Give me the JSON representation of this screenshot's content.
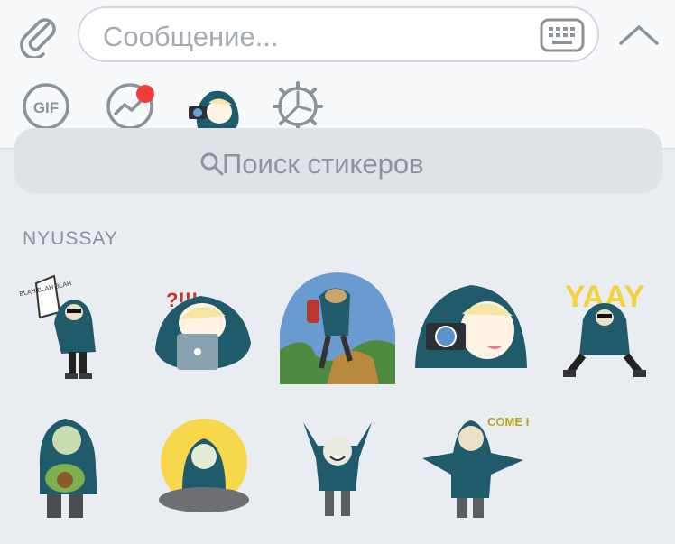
{
  "composer": {
    "placeholder": "Сообщение..."
  },
  "tabs": [
    {
      "name": "gif",
      "label": "GIF"
    },
    {
      "name": "trending"
    },
    {
      "name": "sticker-pack-nyussay"
    },
    {
      "name": "settings"
    }
  ],
  "search": {
    "placeholder": "Поиск стикеров"
  },
  "pack": {
    "title": "NYUSSAY",
    "stickers": [
      {
        "id": 1,
        "caption": "BLAH BLAH BLAH"
      },
      {
        "id": 2,
        "caption": "?!!!"
      },
      {
        "id": 3,
        "caption": ""
      },
      {
        "id": 4,
        "caption": ""
      },
      {
        "id": 5,
        "caption": "YAAY"
      },
      {
        "id": 6,
        "caption": ""
      },
      {
        "id": 7,
        "caption": ""
      },
      {
        "id": 8,
        "caption": ""
      },
      {
        "id": 9,
        "caption": "COME HERE"
      }
    ]
  },
  "colors": {
    "hoodie": "#1f5b6b",
    "accent_red": "#f23d3d",
    "bg": "#e9ecf1"
  }
}
